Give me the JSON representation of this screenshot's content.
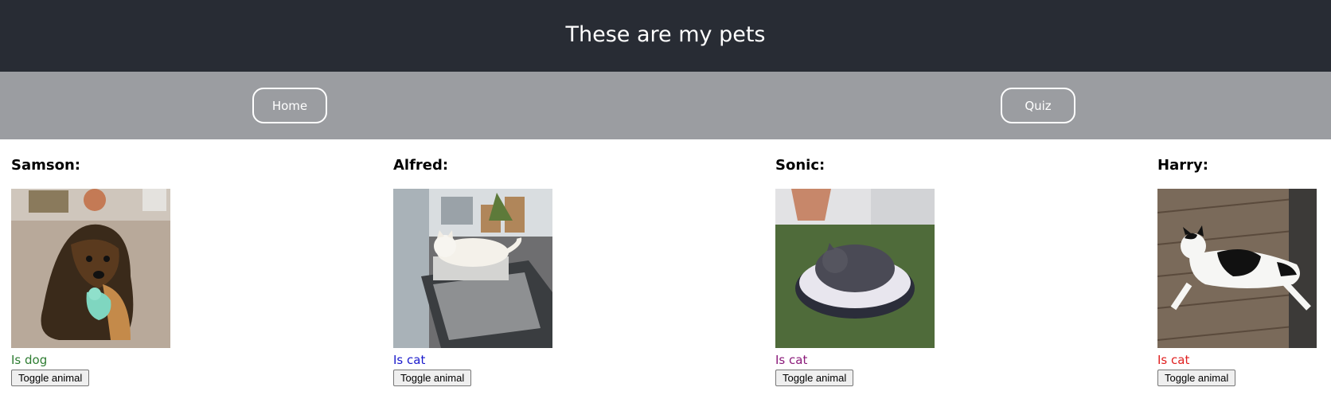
{
  "header": {
    "title": "These are my pets"
  },
  "nav": {
    "home_label": "Home",
    "quiz_label": "Quiz"
  },
  "pets": [
    {
      "name": "Samson:",
      "status": "Is dog",
      "status_color": "#2e7d32",
      "button_label": "Toggle animal",
      "image_icon": "dog-photo"
    },
    {
      "name": "Alfred:",
      "status": "Is cat",
      "status_color": "#1a1acc",
      "button_label": "Toggle animal",
      "image_icon": "cat-photo"
    },
    {
      "name": "Sonic:",
      "status": "Is cat",
      "status_color": "#8b1a7a",
      "button_label": "Toggle animal",
      "image_icon": "cat-photo"
    },
    {
      "name": "Harry:",
      "status": "Is cat",
      "status_color": "#e02020",
      "button_label": "Toggle animal",
      "image_icon": "cat-photo"
    }
  ],
  "colors": {
    "header_bg": "#282c34",
    "nav_bg": "#9b9da1"
  }
}
